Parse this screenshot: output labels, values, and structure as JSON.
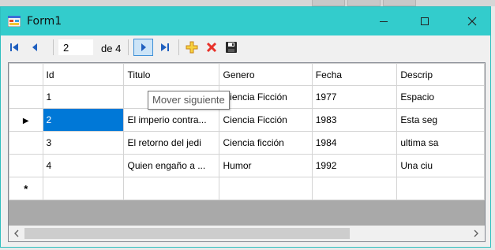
{
  "window": {
    "title": "Form1",
    "accent_color": "#33cccc"
  },
  "navigator": {
    "position": "2",
    "of_label": "de 4"
  },
  "tooltip": "Mover siguiente",
  "grid": {
    "columns": [
      "Id",
      "Titulo",
      "Genero",
      "Fecha",
      "Descrip"
    ],
    "rows": [
      [
        "1",
        "",
        "Ciencia Ficción",
        "1977",
        "Espacio"
      ],
      [
        "2",
        "El imperio contra...",
        "Ciencia Ficción",
        "1983",
        "Esta seg"
      ],
      [
        "3",
        "El retorno del jedi",
        "Ciencia ficción",
        "1984",
        "ultima sa"
      ],
      [
        "4",
        "Quien engaño a ...",
        "Humor",
        "1992",
        "Una ciu"
      ]
    ],
    "new_row_marker": "*",
    "current_row_marker": "▶",
    "selection_color": "#0078d7"
  }
}
